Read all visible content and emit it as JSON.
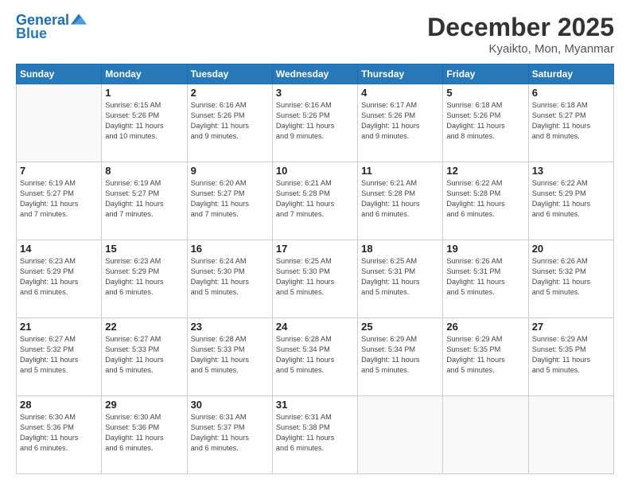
{
  "header": {
    "logo_line1": "General",
    "logo_line2": "Blue",
    "month_title": "December 2025",
    "location": "Kyaikto, Mon, Myanmar"
  },
  "days_of_week": [
    "Sunday",
    "Monday",
    "Tuesday",
    "Wednesday",
    "Thursday",
    "Friday",
    "Saturday"
  ],
  "weeks": [
    [
      {
        "day": "",
        "text": ""
      },
      {
        "day": "1",
        "text": "Sunrise: 6:15 AM\nSunset: 5:26 PM\nDaylight: 11 hours\nand 10 minutes."
      },
      {
        "day": "2",
        "text": "Sunrise: 6:16 AM\nSunset: 5:26 PM\nDaylight: 11 hours\nand 9 minutes."
      },
      {
        "day": "3",
        "text": "Sunrise: 6:16 AM\nSunset: 5:26 PM\nDaylight: 11 hours\nand 9 minutes."
      },
      {
        "day": "4",
        "text": "Sunrise: 6:17 AM\nSunset: 5:26 PM\nDaylight: 11 hours\nand 9 minutes."
      },
      {
        "day": "5",
        "text": "Sunrise: 6:18 AM\nSunset: 5:26 PM\nDaylight: 11 hours\nand 8 minutes."
      },
      {
        "day": "6",
        "text": "Sunrise: 6:18 AM\nSunset: 5:27 PM\nDaylight: 11 hours\nand 8 minutes."
      }
    ],
    [
      {
        "day": "7",
        "text": "Sunrise: 6:19 AM\nSunset: 5:27 PM\nDaylight: 11 hours\nand 7 minutes."
      },
      {
        "day": "8",
        "text": "Sunrise: 6:19 AM\nSunset: 5:27 PM\nDaylight: 11 hours\nand 7 minutes."
      },
      {
        "day": "9",
        "text": "Sunrise: 6:20 AM\nSunset: 5:27 PM\nDaylight: 11 hours\nand 7 minutes."
      },
      {
        "day": "10",
        "text": "Sunrise: 6:21 AM\nSunset: 5:28 PM\nDaylight: 11 hours\nand 7 minutes."
      },
      {
        "day": "11",
        "text": "Sunrise: 6:21 AM\nSunset: 5:28 PM\nDaylight: 11 hours\nand 6 minutes."
      },
      {
        "day": "12",
        "text": "Sunrise: 6:22 AM\nSunset: 5:28 PM\nDaylight: 11 hours\nand 6 minutes."
      },
      {
        "day": "13",
        "text": "Sunrise: 6:22 AM\nSunset: 5:29 PM\nDaylight: 11 hours\nand 6 minutes."
      }
    ],
    [
      {
        "day": "14",
        "text": "Sunrise: 6:23 AM\nSunset: 5:29 PM\nDaylight: 11 hours\nand 6 minutes."
      },
      {
        "day": "15",
        "text": "Sunrise: 6:23 AM\nSunset: 5:29 PM\nDaylight: 11 hours\nand 6 minutes."
      },
      {
        "day": "16",
        "text": "Sunrise: 6:24 AM\nSunset: 5:30 PM\nDaylight: 11 hours\nand 5 minutes."
      },
      {
        "day": "17",
        "text": "Sunrise: 6:25 AM\nSunset: 5:30 PM\nDaylight: 11 hours\nand 5 minutes."
      },
      {
        "day": "18",
        "text": "Sunrise: 6:25 AM\nSunset: 5:31 PM\nDaylight: 11 hours\nand 5 minutes."
      },
      {
        "day": "19",
        "text": "Sunrise: 6:26 AM\nSunset: 5:31 PM\nDaylight: 11 hours\nand 5 minutes."
      },
      {
        "day": "20",
        "text": "Sunrise: 6:26 AM\nSunset: 5:32 PM\nDaylight: 11 hours\nand 5 minutes."
      }
    ],
    [
      {
        "day": "21",
        "text": "Sunrise: 6:27 AM\nSunset: 5:32 PM\nDaylight: 11 hours\nand 5 minutes."
      },
      {
        "day": "22",
        "text": "Sunrise: 6:27 AM\nSunset: 5:33 PM\nDaylight: 11 hours\nand 5 minutes."
      },
      {
        "day": "23",
        "text": "Sunrise: 6:28 AM\nSunset: 5:33 PM\nDaylight: 11 hours\nand 5 minutes."
      },
      {
        "day": "24",
        "text": "Sunrise: 6:28 AM\nSunset: 5:34 PM\nDaylight: 11 hours\nand 5 minutes."
      },
      {
        "day": "25",
        "text": "Sunrise: 6:29 AM\nSunset: 5:34 PM\nDaylight: 11 hours\nand 5 minutes."
      },
      {
        "day": "26",
        "text": "Sunrise: 6:29 AM\nSunset: 5:35 PM\nDaylight: 11 hours\nand 5 minutes."
      },
      {
        "day": "27",
        "text": "Sunrise: 6:29 AM\nSunset: 5:35 PM\nDaylight: 11 hours\nand 5 minutes."
      }
    ],
    [
      {
        "day": "28",
        "text": "Sunrise: 6:30 AM\nSunset: 5:36 PM\nDaylight: 11 hours\nand 6 minutes."
      },
      {
        "day": "29",
        "text": "Sunrise: 6:30 AM\nSunset: 5:36 PM\nDaylight: 11 hours\nand 6 minutes."
      },
      {
        "day": "30",
        "text": "Sunrise: 6:31 AM\nSunset: 5:37 PM\nDaylight: 11 hours\nand 6 minutes."
      },
      {
        "day": "31",
        "text": "Sunrise: 6:31 AM\nSunset: 5:38 PM\nDaylight: 11 hours\nand 6 minutes."
      },
      {
        "day": "",
        "text": ""
      },
      {
        "day": "",
        "text": ""
      },
      {
        "day": "",
        "text": ""
      }
    ]
  ]
}
